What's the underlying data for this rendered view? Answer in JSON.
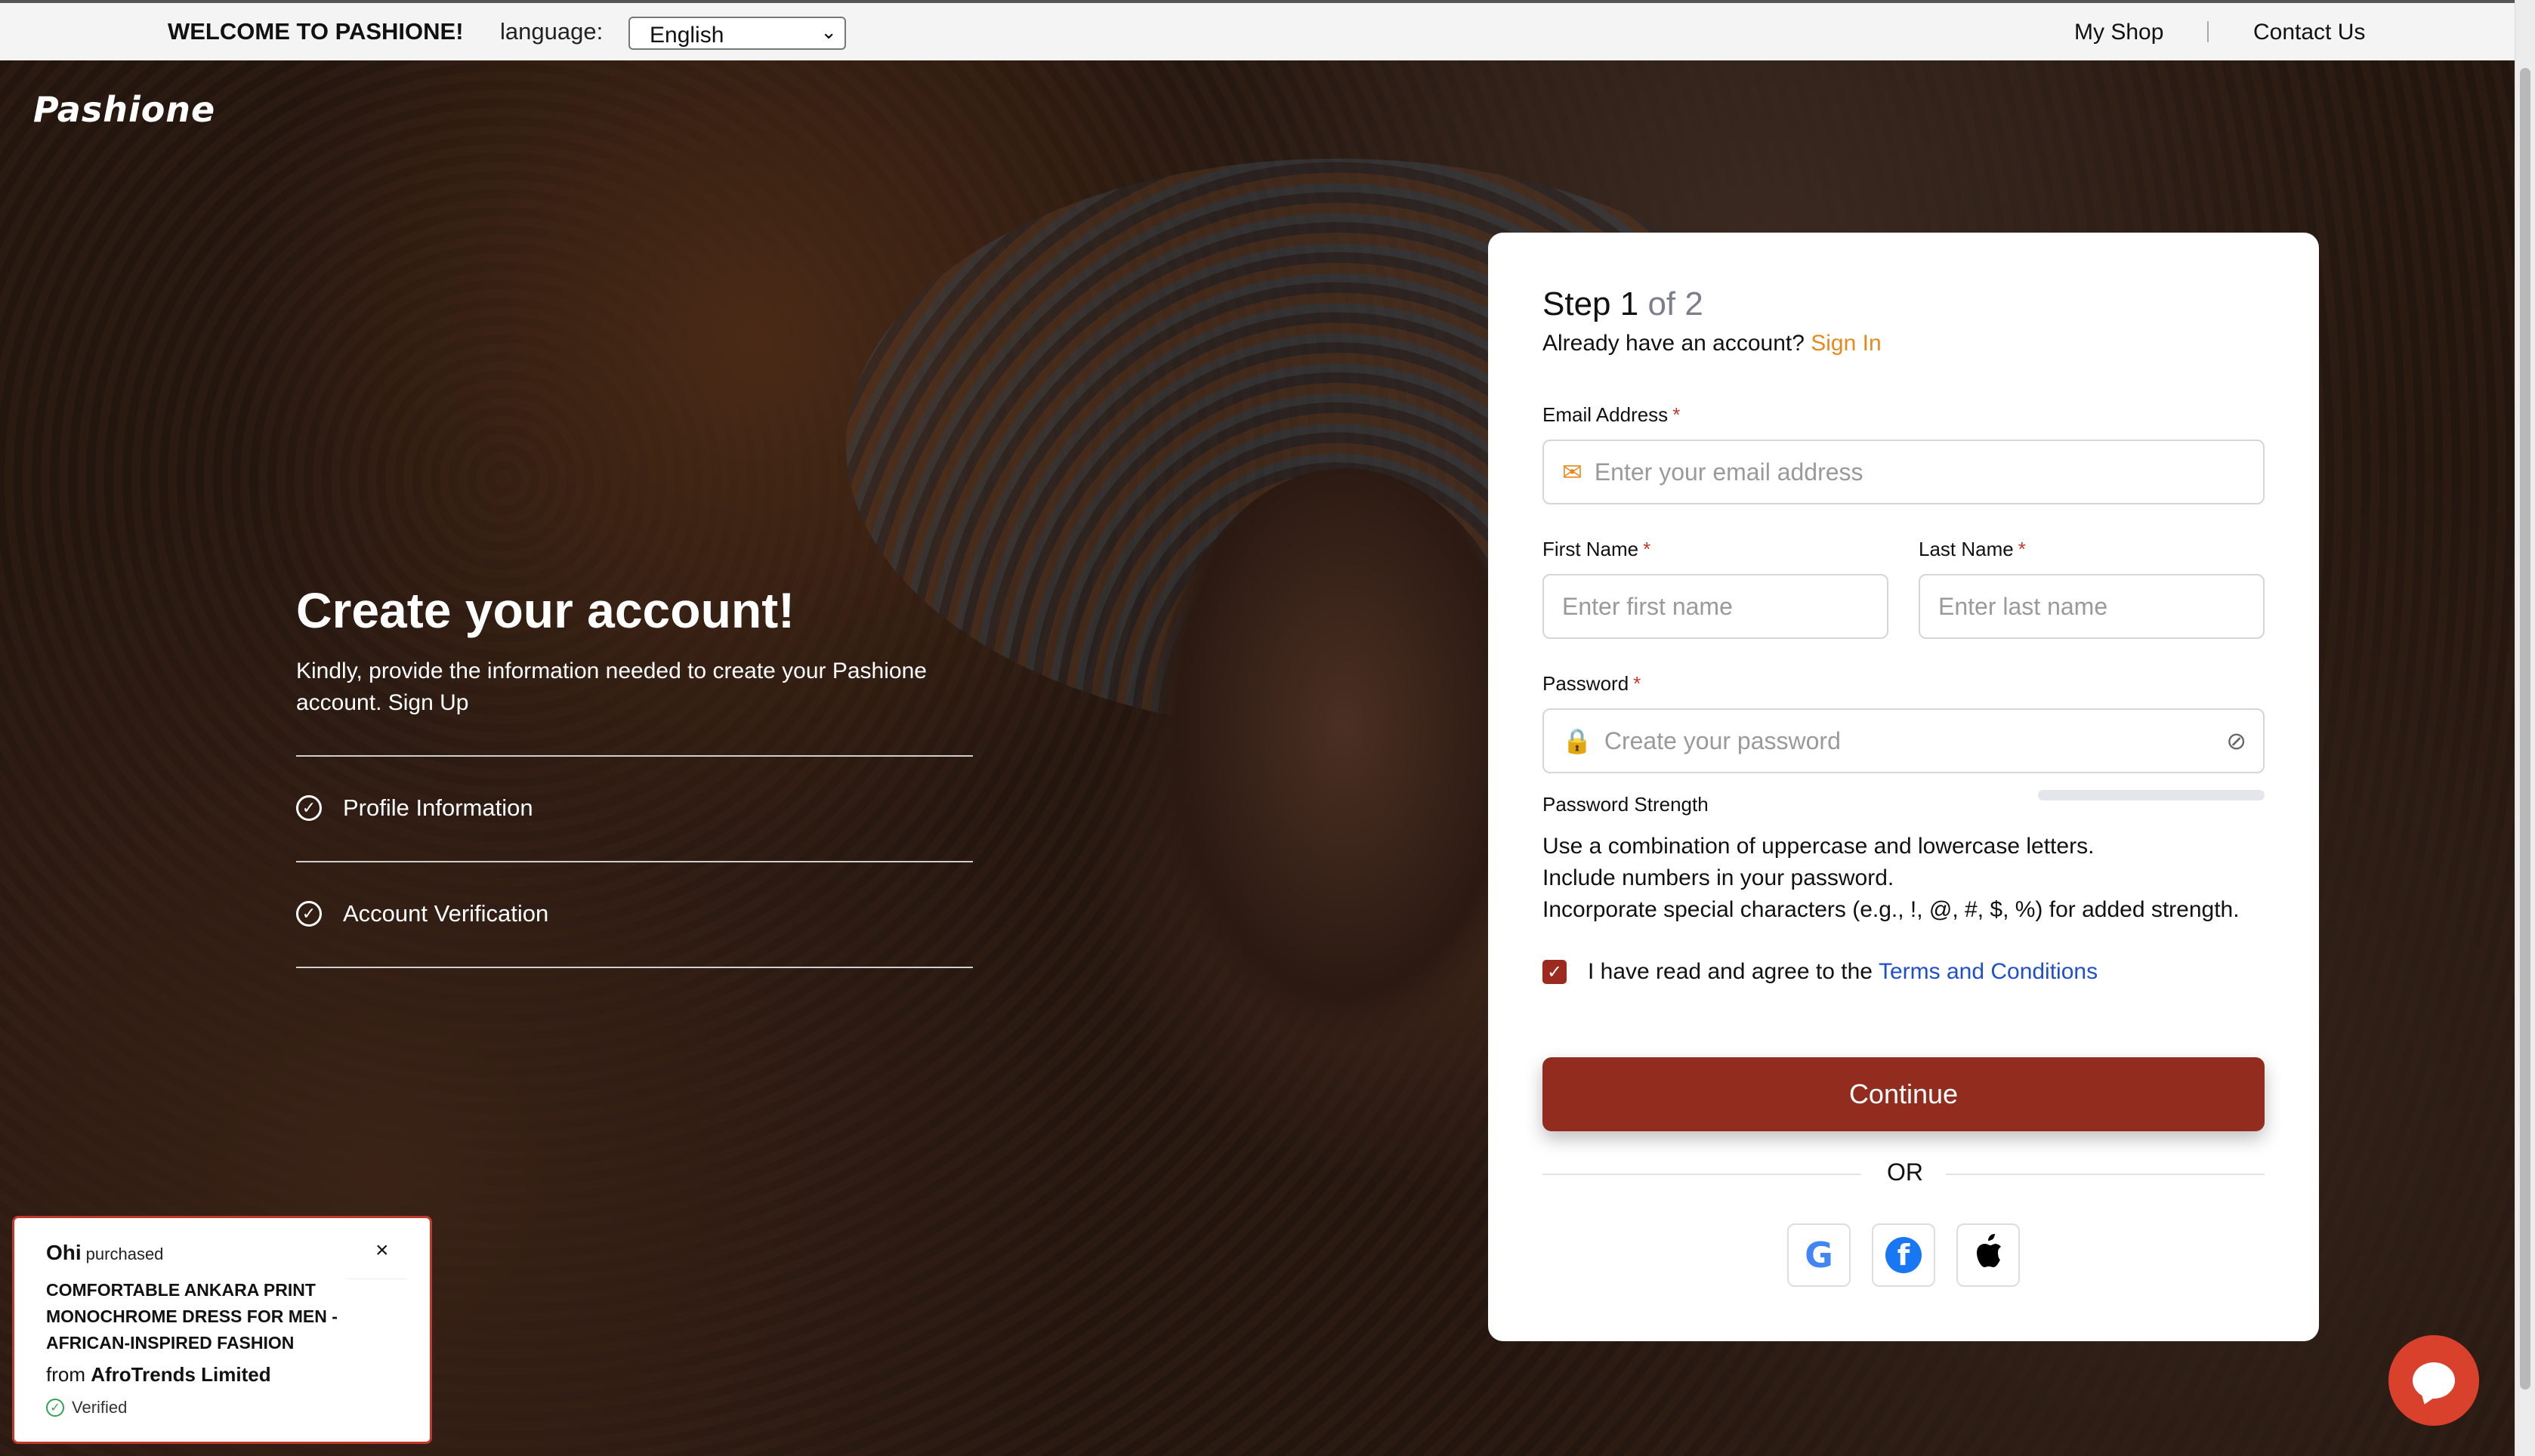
{
  "topbar": {
    "welcome": "WELCOME TO PASHIONE!",
    "language_label": "language:",
    "language_selected": "English",
    "nav": {
      "my_shop": "My Shop",
      "contact_us": "Contact Us"
    }
  },
  "brand": {
    "logo_text": "Pashione"
  },
  "left": {
    "title": "Create your account!",
    "subtitle": "Kindly, provide the information needed to create your Pashione account. Sign Up",
    "steps": [
      {
        "label": "Profile Information"
      },
      {
        "label": "Account Verification"
      }
    ]
  },
  "form": {
    "step_prefix": "Step 1",
    "step_suffix": "of 2",
    "have_account": "Already have an account?",
    "sign_in": "Sign In",
    "email": {
      "label": "Email Address",
      "required": "*",
      "placeholder": "Enter your email address"
    },
    "first_name": {
      "label": "First Name",
      "required": "*",
      "placeholder": "Enter first name"
    },
    "last_name": {
      "label": "Last Name",
      "required": "*",
      "placeholder": "Enter last name"
    },
    "password": {
      "label": "Password",
      "required": "*",
      "placeholder": "Create your password"
    },
    "strength_label": "Password Strength",
    "strength_value": 0,
    "tips": [
      "Use a combination of uppercase and lowercase letters.",
      "Include numbers in your password.",
      "Incorporate special characters (e.g., !, @, #, $, %) for added strength."
    ],
    "agree_text": "I have read and agree to the",
    "terms_link": "Terms and Conditions",
    "agree_checked": true,
    "continue_label": "Continue",
    "or_text": "OR",
    "social": [
      {
        "icon": "google-icon",
        "glyph": "G"
      },
      {
        "icon": "facebook-icon",
        "glyph": "f"
      },
      {
        "icon": "apple-icon",
        "glyph": ""
      }
    ]
  },
  "toast": {
    "buyer": "Ohi",
    "action": "purchased",
    "product": "COMFORTABLE ANKARA PRINT MONOCHROME DRESS FOR MEN - AFRICAN-INSPIRED FASHION",
    "from_prefix": "from",
    "seller": "AfroTrends Limited",
    "verified": "Verified",
    "close": "×"
  },
  "colors": {
    "accent": "#922c1e",
    "link_orange": "#e58a1f",
    "link_blue": "#1f4fcf",
    "chat": "#d9412c"
  }
}
